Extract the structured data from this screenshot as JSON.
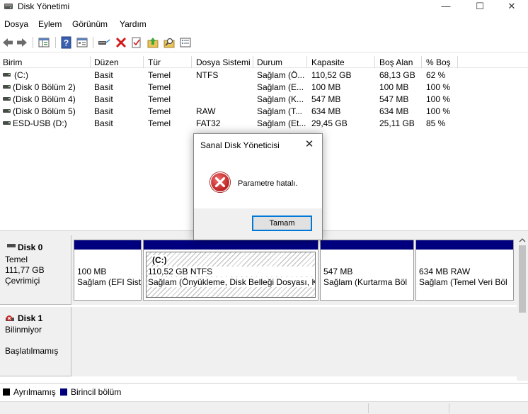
{
  "window": {
    "title": "Disk Yönetimi",
    "controls": {
      "minimize": "—",
      "maximize": "☐",
      "close": "✕"
    }
  },
  "menu": [
    "Dosya",
    "Eylem",
    "Görünüm",
    "Yardım"
  ],
  "toolbar": {
    "icons": [
      "back-icon",
      "forward-icon",
      "console-tree-icon",
      "help-icon",
      "properties-icon",
      "connect-icon",
      "delete-icon",
      "check-icon",
      "up-icon",
      "search-icon",
      "list-icon"
    ]
  },
  "volume_list": {
    "columns": [
      "Birim",
      "Düzen",
      "Tür",
      "Dosya Sistemi",
      "Durum",
      "Kapasite",
      "Boş Alan",
      "% Boş"
    ],
    "rows": [
      [
        "(C:)",
        "Basit",
        "Temel",
        "NTFS",
        "Sağlam (Ö...",
        "110,52 GB",
        "68,13 GB",
        "62 %"
      ],
      [
        "(Disk 0 Bölüm 2)",
        "Basit",
        "Temel",
        "",
        "Sağlam (E...",
        "100 MB",
        "100 MB",
        "100 %"
      ],
      [
        "(Disk 0 Bölüm 4)",
        "Basit",
        "Temel",
        "",
        "Sağlam (K...",
        "547 MB",
        "547 MB",
        "100 %"
      ],
      [
        "(Disk 0 Bölüm 5)",
        "Basit",
        "Temel",
        "RAW",
        "Sağlam (T...",
        "634 MB",
        "634 MB",
        "100 %"
      ],
      [
        "ESD-USB (D:)",
        "Basit",
        "Temel",
        "FAT32",
        "Sağlam (Et...",
        "29,45 GB",
        "25,11 GB",
        "85 %"
      ]
    ]
  },
  "disks": [
    {
      "name": "Disk 0",
      "type": "Temel",
      "size": "111,77 GB",
      "state": "Çevrimiçi",
      "partitions": [
        {
          "title": "",
          "line1": "100 MB",
          "line2": "Sağlam (EFI Sist"
        },
        {
          "title": "(C:)",
          "line1": "110,52 GB NTFS",
          "line2": "Sağlam (Önyükleme, Disk Belleği Dosyası, Kil"
        },
        {
          "title": "",
          "line1": "547 MB",
          "line2": "Sağlam (Kurtarma Böl"
        },
        {
          "title": "",
          "line1": "634 MB RAW",
          "line2": "Sağlam (Temel Veri Böl"
        }
      ]
    },
    {
      "name": "Disk 1",
      "type": "Bilinmiyor",
      "state": "Başlatılmamış"
    }
  ],
  "legend": {
    "items": [
      {
        "label": "Ayrılmamış",
        "color": "#000000"
      },
      {
        "label": "Birincil bölüm",
        "color": "#00007f"
      }
    ]
  },
  "dialog": {
    "title": "Sanal Disk Yöneticisi",
    "message": "Parametre hatalı.",
    "ok_label": "Tamam",
    "close_glyph": "✕"
  }
}
